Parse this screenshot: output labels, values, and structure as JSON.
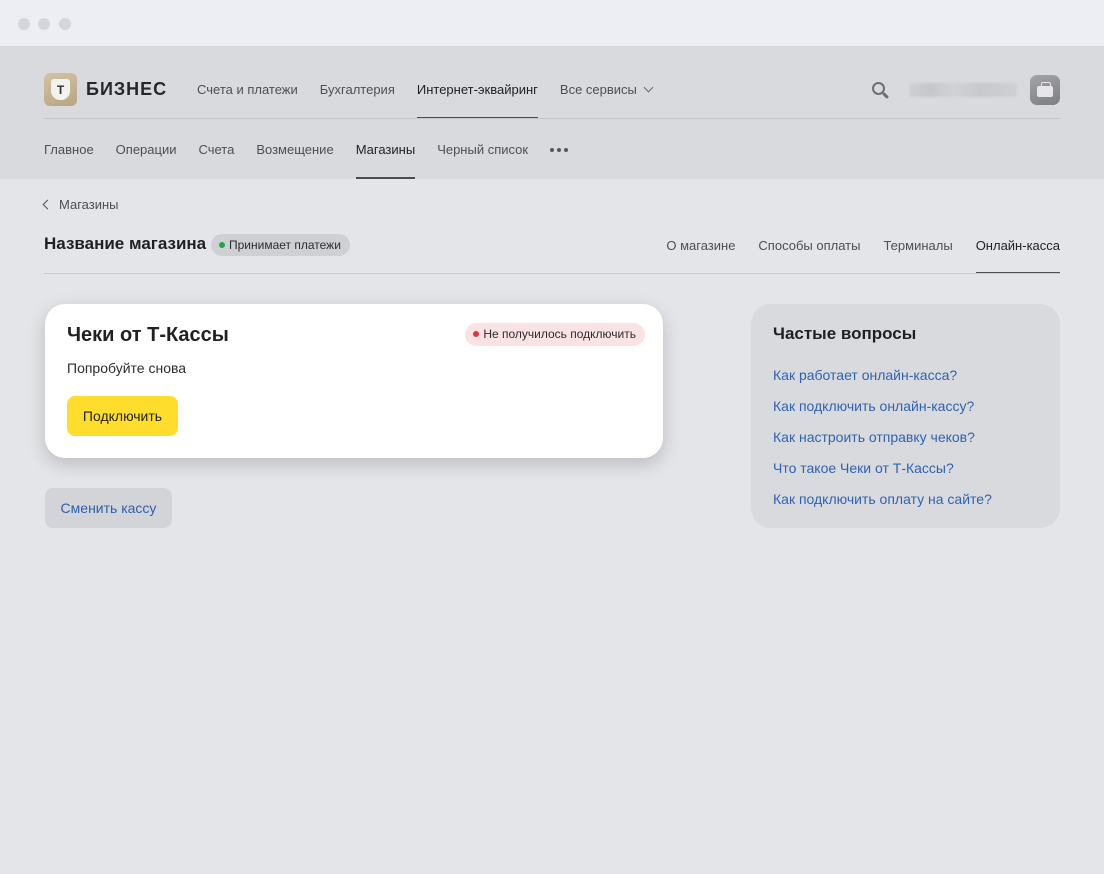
{
  "colors": {
    "accent_yellow": "#ffdd2d",
    "link_blue": "#2f63b0",
    "status_green": "#21a84a",
    "error_red": "#e0363b"
  },
  "header": {
    "logo_text": "БИЗНЕС",
    "logo_letter": "Т",
    "top_nav": [
      {
        "label": "Счета и платежи",
        "active": false
      },
      {
        "label": "Бухгалтерия",
        "active": false
      },
      {
        "label": "Интернет-эквайринг",
        "active": true
      },
      {
        "label": "Все сервисы",
        "active": false
      }
    ],
    "icons": {
      "search": "search-icon",
      "avatar": "briefcase-icon",
      "dropdown": "chevron-down-icon"
    }
  },
  "sub_nav": [
    {
      "label": "Главное",
      "active": false
    },
    {
      "label": "Операции",
      "active": false
    },
    {
      "label": "Счета",
      "active": false
    },
    {
      "label": "Возмещение",
      "active": false
    },
    {
      "label": "Магазины",
      "active": true
    },
    {
      "label": "Черный список",
      "active": false
    }
  ],
  "breadcrumb": {
    "back_label": "Магазины"
  },
  "store": {
    "title": "Название магазина",
    "status": "Принимает платежи",
    "tabs": [
      {
        "label": "О магазине",
        "active": false
      },
      {
        "label": "Способы оплаты",
        "active": false
      },
      {
        "label": "Терминалы",
        "active": false
      },
      {
        "label": "Онлайн-касса",
        "active": true
      }
    ]
  },
  "card": {
    "title": "Чеки от Т-Кассы",
    "error_badge": "Не получилось подключить",
    "subtitle": "Попробуйте снова",
    "connect_label": "Подключить"
  },
  "change_label": "Сменить кассу",
  "faq": {
    "title": "Частые вопросы",
    "links": [
      "Как работает онлайн-касса?",
      "Как подключить онлайн-кассу?",
      "Как настроить отправку чеков?",
      "Что такое Чеки от Т-Кассы?",
      "Как подключить оплату на сайте?"
    ]
  }
}
